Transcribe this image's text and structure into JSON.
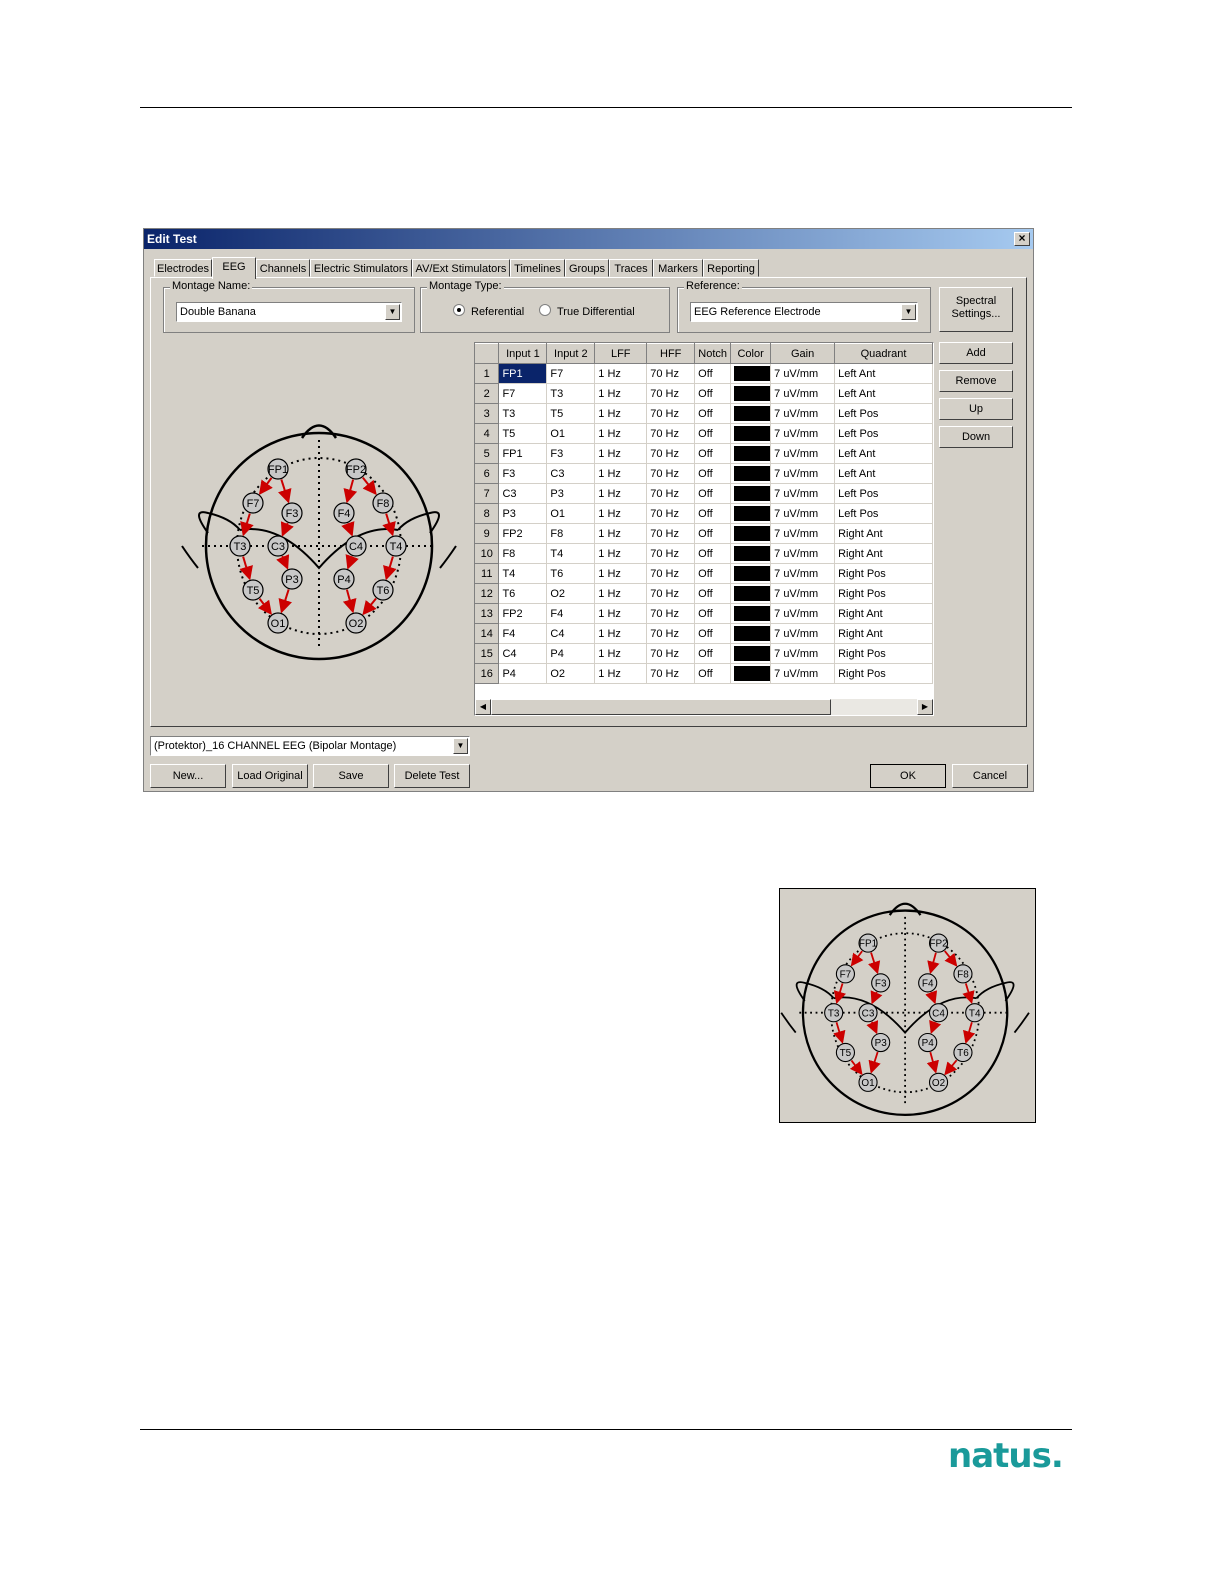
{
  "dialog": {
    "title": "Edit Test",
    "close_label": "×",
    "tabs": [
      "Electrodes",
      "EEG",
      "Channels",
      "Electric Stimulators",
      "AV/Ext Stimulators",
      "Timelines",
      "Groups",
      "Traces",
      "Markers",
      "Reporting"
    ],
    "active_tab": "EEG",
    "montage_name_label": "Montage Name:",
    "montage_name_value": "Double Banana",
    "montage_type_label": "Montage Type:",
    "montage_type_options": [
      "Referential",
      "True Differential"
    ],
    "montage_type_selected": "Referential",
    "reference_label": "Reference:",
    "reference_value": "EEG Reference Electrode",
    "spectral_button": "Spectral Settings...",
    "side_buttons": [
      "Add",
      "Remove",
      "Up",
      "Down"
    ],
    "grid_headers": [
      "Input 1",
      "Input 2",
      "LFF",
      "HFF",
      "Notch",
      "Color",
      "Gain",
      "Quadrant"
    ],
    "grid_rows": [
      {
        "n": "1",
        "in1": "FP1",
        "in2": "F7",
        "lff": "1 Hz",
        "hff": "70 Hz",
        "notch": "Off",
        "color": "#000000",
        "gain": "7 uV/mm",
        "quad": "Left Ant"
      },
      {
        "n": "2",
        "in1": "F7",
        "in2": "T3",
        "lff": "1 Hz",
        "hff": "70 Hz",
        "notch": "Off",
        "color": "#000000",
        "gain": "7 uV/mm",
        "quad": "Left Ant"
      },
      {
        "n": "3",
        "in1": "T3",
        "in2": "T5",
        "lff": "1 Hz",
        "hff": "70 Hz",
        "notch": "Off",
        "color": "#000000",
        "gain": "7 uV/mm",
        "quad": "Left Pos"
      },
      {
        "n": "4",
        "in1": "T5",
        "in2": "O1",
        "lff": "1 Hz",
        "hff": "70 Hz",
        "notch": "Off",
        "color": "#000000",
        "gain": "7 uV/mm",
        "quad": "Left Pos"
      },
      {
        "n": "5",
        "in1": "FP1",
        "in2": "F3",
        "lff": "1 Hz",
        "hff": "70 Hz",
        "notch": "Off",
        "color": "#000000",
        "gain": "7 uV/mm",
        "quad": "Left Ant"
      },
      {
        "n": "6",
        "in1": "F3",
        "in2": "C3",
        "lff": "1 Hz",
        "hff": "70 Hz",
        "notch": "Off",
        "color": "#000000",
        "gain": "7 uV/mm",
        "quad": "Left Ant"
      },
      {
        "n": "7",
        "in1": "C3",
        "in2": "P3",
        "lff": "1 Hz",
        "hff": "70 Hz",
        "notch": "Off",
        "color": "#000000",
        "gain": "7 uV/mm",
        "quad": "Left Pos"
      },
      {
        "n": "8",
        "in1": "P3",
        "in2": "O1",
        "lff": "1 Hz",
        "hff": "70 Hz",
        "notch": "Off",
        "color": "#000000",
        "gain": "7 uV/mm",
        "quad": "Left Pos"
      },
      {
        "n": "9",
        "in1": "FP2",
        "in2": "F8",
        "lff": "1 Hz",
        "hff": "70 Hz",
        "notch": "Off",
        "color": "#000000",
        "gain": "7 uV/mm",
        "quad": "Right Ant"
      },
      {
        "n": "10",
        "in1": "F8",
        "in2": "T4",
        "lff": "1 Hz",
        "hff": "70 Hz",
        "notch": "Off",
        "color": "#000000",
        "gain": "7 uV/mm",
        "quad": "Right Ant"
      },
      {
        "n": "11",
        "in1": "T4",
        "in2": "T6",
        "lff": "1 Hz",
        "hff": "70 Hz",
        "notch": "Off",
        "color": "#000000",
        "gain": "7 uV/mm",
        "quad": "Right Pos"
      },
      {
        "n": "12",
        "in1": "T6",
        "in2": "O2",
        "lff": "1 Hz",
        "hff": "70 Hz",
        "notch": "Off",
        "color": "#000000",
        "gain": "7 uV/mm",
        "quad": "Right Pos"
      },
      {
        "n": "13",
        "in1": "FP2",
        "in2": "F4",
        "lff": "1 Hz",
        "hff": "70 Hz",
        "notch": "Off",
        "color": "#000000",
        "gain": "7 uV/mm",
        "quad": "Right Ant"
      },
      {
        "n": "14",
        "in1": "F4",
        "in2": "C4",
        "lff": "1 Hz",
        "hff": "70 Hz",
        "notch": "Off",
        "color": "#000000",
        "gain": "7 uV/mm",
        "quad": "Right Ant"
      },
      {
        "n": "15",
        "in1": "C4",
        "in2": "P4",
        "lff": "1 Hz",
        "hff": "70 Hz",
        "notch": "Off",
        "color": "#000000",
        "gain": "7 uV/mm",
        "quad": "Right Pos"
      },
      {
        "n": "16",
        "in1": "P4",
        "in2": "O2",
        "lff": "1 Hz",
        "hff": "70 Hz",
        "notch": "Off",
        "color": "#000000",
        "gain": "7 uV/mm",
        "quad": "Right Pos"
      }
    ],
    "test_select_value": "(Protektor)_16 CHANNEL EEG (Bipolar Montage)",
    "bottom_buttons": [
      "New...",
      "Load Original",
      "Save",
      "Delete Test"
    ],
    "ok_label": "OK",
    "cancel_label": "Cancel"
  },
  "head_map": {
    "electrodes": [
      "FP1",
      "FP2",
      "F7",
      "F3",
      "F4",
      "F8",
      "T3",
      "C3",
      "C4",
      "T4",
      "T5",
      "P3",
      "P4",
      "T6",
      "O1",
      "O2"
    ],
    "arrow_color": "#cc0000"
  },
  "footer": {
    "logo_text": "natus.",
    "logo_color": "#1a9a9a"
  }
}
